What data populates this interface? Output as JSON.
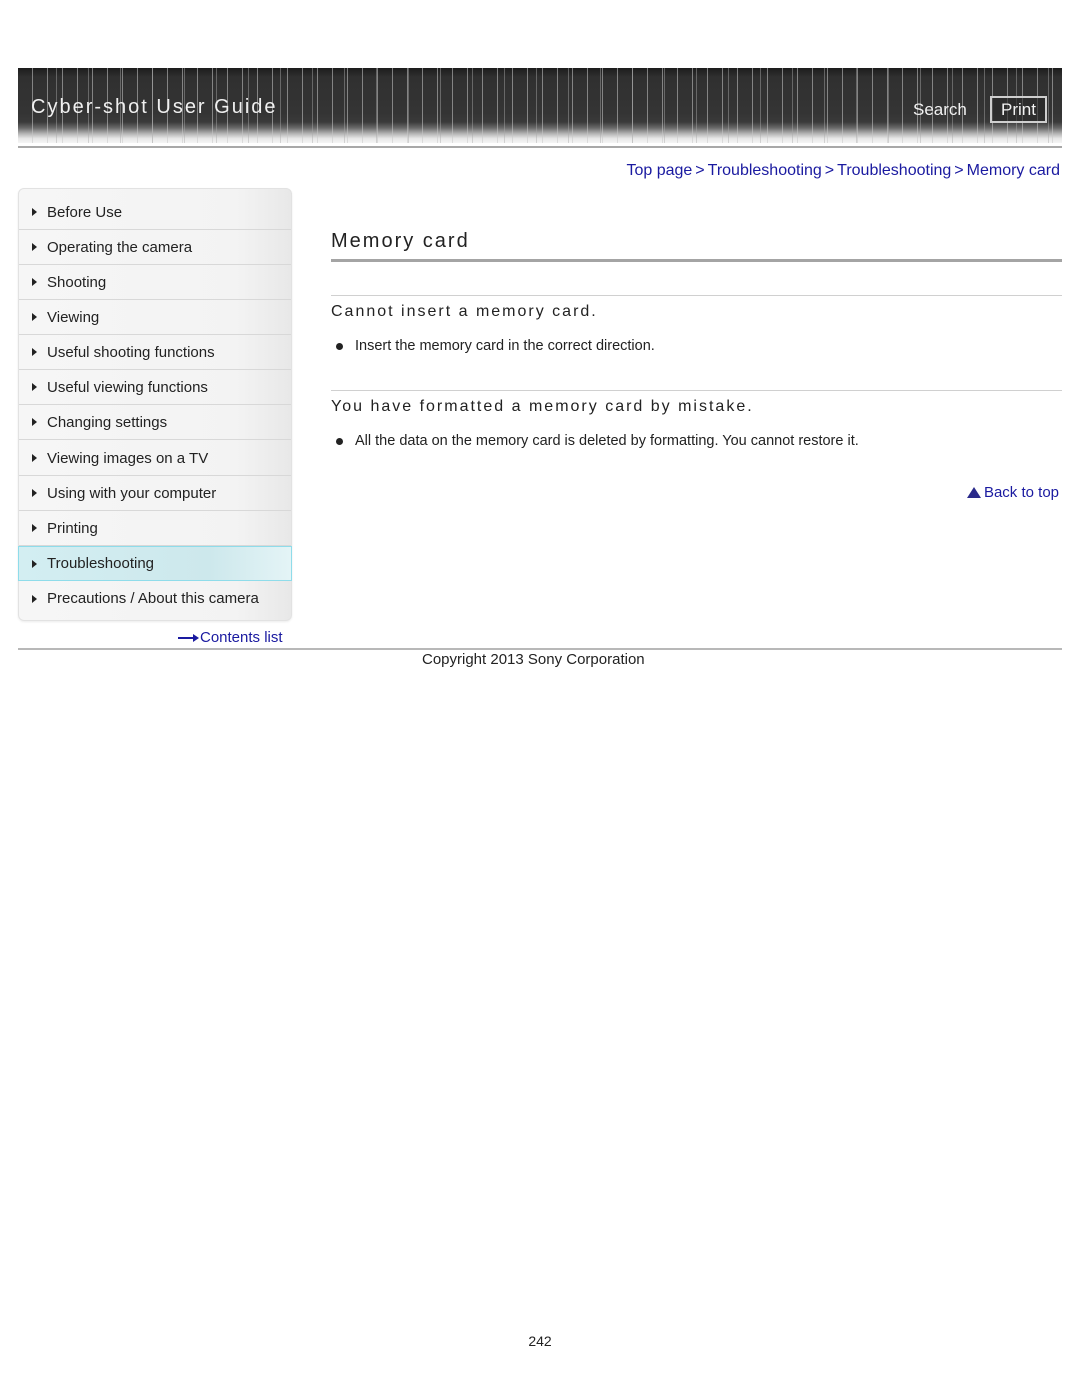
{
  "header": {
    "app_title": "Cyber-shot User Guide",
    "search_label": "Search",
    "print_label": "Print"
  },
  "breadcrumb": {
    "items": [
      "Top page",
      "Troubleshooting",
      "Troubleshooting",
      "Memory card"
    ],
    "separator": ">"
  },
  "sidebar": {
    "items": [
      {
        "label": "Before Use"
      },
      {
        "label": "Operating the camera"
      },
      {
        "label": "Shooting"
      },
      {
        "label": "Viewing"
      },
      {
        "label": "Useful shooting functions"
      },
      {
        "label": "Useful viewing functions"
      },
      {
        "label": "Changing settings"
      },
      {
        "label": "Viewing images on a TV"
      },
      {
        "label": "Using with your computer"
      },
      {
        "label": "Printing"
      },
      {
        "label": "Troubleshooting",
        "active": true
      },
      {
        "label": "Precautions / About this camera"
      }
    ],
    "contents_link": "Contents list"
  },
  "main": {
    "title": "Memory card",
    "sections": [
      {
        "heading": "Cannot insert a memory card.",
        "bullets": [
          "Insert the memory card in the correct direction."
        ]
      },
      {
        "heading": "You have formatted a memory card by mistake.",
        "bullets": [
          "All the data on the memory card is deleted by formatting. You cannot restore it."
        ]
      }
    ],
    "back_to_top": "Back to top"
  },
  "footer": {
    "copyright": "Copyright 2013 Sony Corporation",
    "page_number": "242"
  },
  "colors": {
    "link": "#1a1aa0",
    "active_nav_bg": "#d3eef2",
    "active_nav_border": "#8fdcea",
    "header_bg": "#343434"
  }
}
